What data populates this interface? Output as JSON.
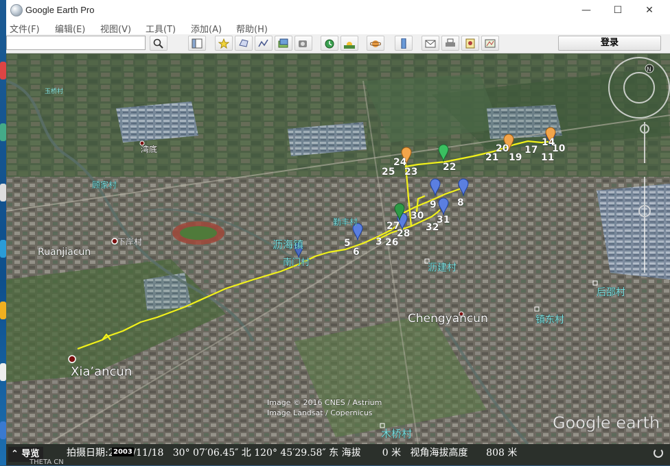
{
  "window": {
    "title": "Google Earth Pro",
    "controls": {
      "minimize": "—",
      "maximize": "☐",
      "close": "✕"
    }
  },
  "menu": [
    "文件(F)",
    "编辑(E)",
    "视图(V)",
    "工具(T)",
    "添加(A)",
    "帮助(H)"
  ],
  "toolbar": {
    "login_label": "登录",
    "search_value": "",
    "buttons": [
      "search-icon",
      "sidebar-icon",
      "placemark-icon",
      "polygon-icon",
      "path-icon",
      "overlay-icon",
      "tour-icon",
      "historical-imagery-icon",
      "sunlight-icon",
      "planets-icon",
      "ruler-icon",
      "email-icon",
      "print-icon",
      "save-image-icon",
      "maps-icon"
    ]
  },
  "map": {
    "labels": {
      "ruanjiacun": "Ruanjiacun",
      "xiaancun": "Xia’ancun",
      "chengyancun": "Chengyancun",
      "lihaizhen": "沥海镇",
      "nanmencun": "南门村",
      "qinfengcun": "勤丰村",
      "lijiancun": "沥建村",
      "houshaocun": "后邵村",
      "zhendongcun": "镇东村",
      "xiaancun_cn": "下岸村",
      "wandi": "湾底",
      "mujiacun": "顾家村",
      "muqiaocun": "木桥村",
      "topleft": "玉桥村"
    },
    "copyright": [
      "Image © 2016 CNES / Astrium",
      "Image Landsat / Copernicus"
    ],
    "watermark": "Google earth",
    "route_points": [
      {
        "n": "3"
      },
      {
        "n": "5"
      },
      {
        "n": "6"
      },
      {
        "n": "8"
      },
      {
        "n": "9"
      },
      {
        "n": "10"
      },
      {
        "n": "11"
      },
      {
        "n": "14"
      },
      {
        "n": "17"
      },
      {
        "n": "19"
      },
      {
        "n": "20"
      },
      {
        "n": "21"
      },
      {
        "n": "22"
      },
      {
        "n": "23"
      },
      {
        "n": "24"
      },
      {
        "n": "25"
      },
      {
        "n": "26"
      },
      {
        "n": "27"
      },
      {
        "n": "28"
      },
      {
        "n": "30"
      },
      {
        "n": "31"
      },
      {
        "n": "32"
      }
    ],
    "colors": {
      "route": "#f2f21a",
      "pin_blue": "#5b7fe0",
      "pin_orange": "#f3a54a",
      "pin_green": "#2ea64a",
      "label_cyan": "#7fe0e0"
    }
  },
  "status": {
    "nav_label": "导览",
    "text": "拍摄日期:2016/11/18   30° 07′06.45″ 北 120° 45′29.58″ 东 海拔       0 米   视角海拔高度      808 米",
    "year_badge": "2003",
    "theta": "THETA CN"
  }
}
